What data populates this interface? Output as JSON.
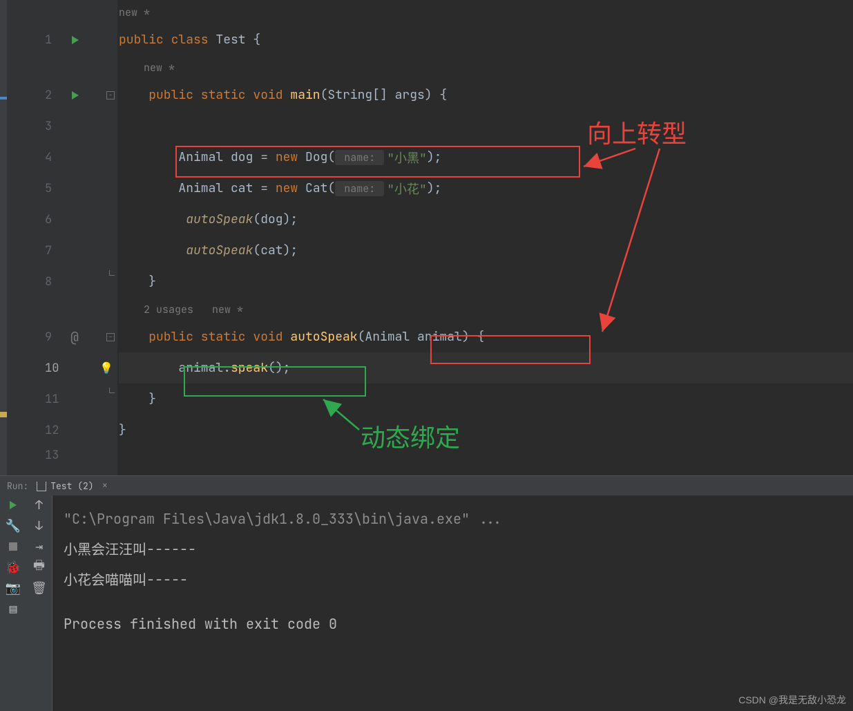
{
  "gutter": {
    "lines": [
      "1",
      "2",
      "3",
      "4",
      "5",
      "6",
      "7",
      "8",
      "9",
      "10",
      "11",
      "12",
      "13"
    ],
    "current": "10"
  },
  "hints": {
    "top": "new *",
    "inner": "new *",
    "usages": "2 usages   new *"
  },
  "code": {
    "l1_pre": "public class ",
    "l1_name": "Test ",
    "l1_brace": "{",
    "l2_a": "    public static void ",
    "l2_b": "main",
    "l2_c": "(String[] args) {",
    "l4_a": "        Animal dog = ",
    "l4_new": "new ",
    "l4_cls": "Dog(",
    "l4_hint": " name: ",
    "l4_str": "\"小黑\"",
    "l4_end": ");",
    "l5_a": "        Animal cat = ",
    "l5_new": "new ",
    "l5_cls": "Cat(",
    "l5_hint": " name: ",
    "l5_str": "\"小花\"",
    "l5_end": ");",
    "l6_a": "         ",
    "l6_m": "autoSpeak",
    "l6_b": "(dog);",
    "l7_a": "         ",
    "l7_m": "autoSpeak",
    "l7_b": "(cat);",
    "l8": "    }",
    "l9_a": "    public static void ",
    "l9_b": "autoSpeak",
    "l9_c": "(",
    "l9_param": "Animal animal",
    "l9_d": ") {",
    "l10_a": "        animal.",
    "l10_b": "speak",
    "l10_c": "();",
    "l11": "    }",
    "l12": "}"
  },
  "annotations": {
    "upcast": "向上转型",
    "dynamic": "动态绑定"
  },
  "run": {
    "label": "Run:",
    "tab": "Test (2)",
    "cmd": "\"C:\\Program Files\\Java\\jdk1.8.0_333\\bin\\java.exe\" ...",
    "out1": "小黑会汪汪叫------",
    "out2": "小花会喵喵叫-----",
    "exit": "Process finished with exit code 0"
  },
  "watermark": "CSDN @我是无敌小恐龙"
}
